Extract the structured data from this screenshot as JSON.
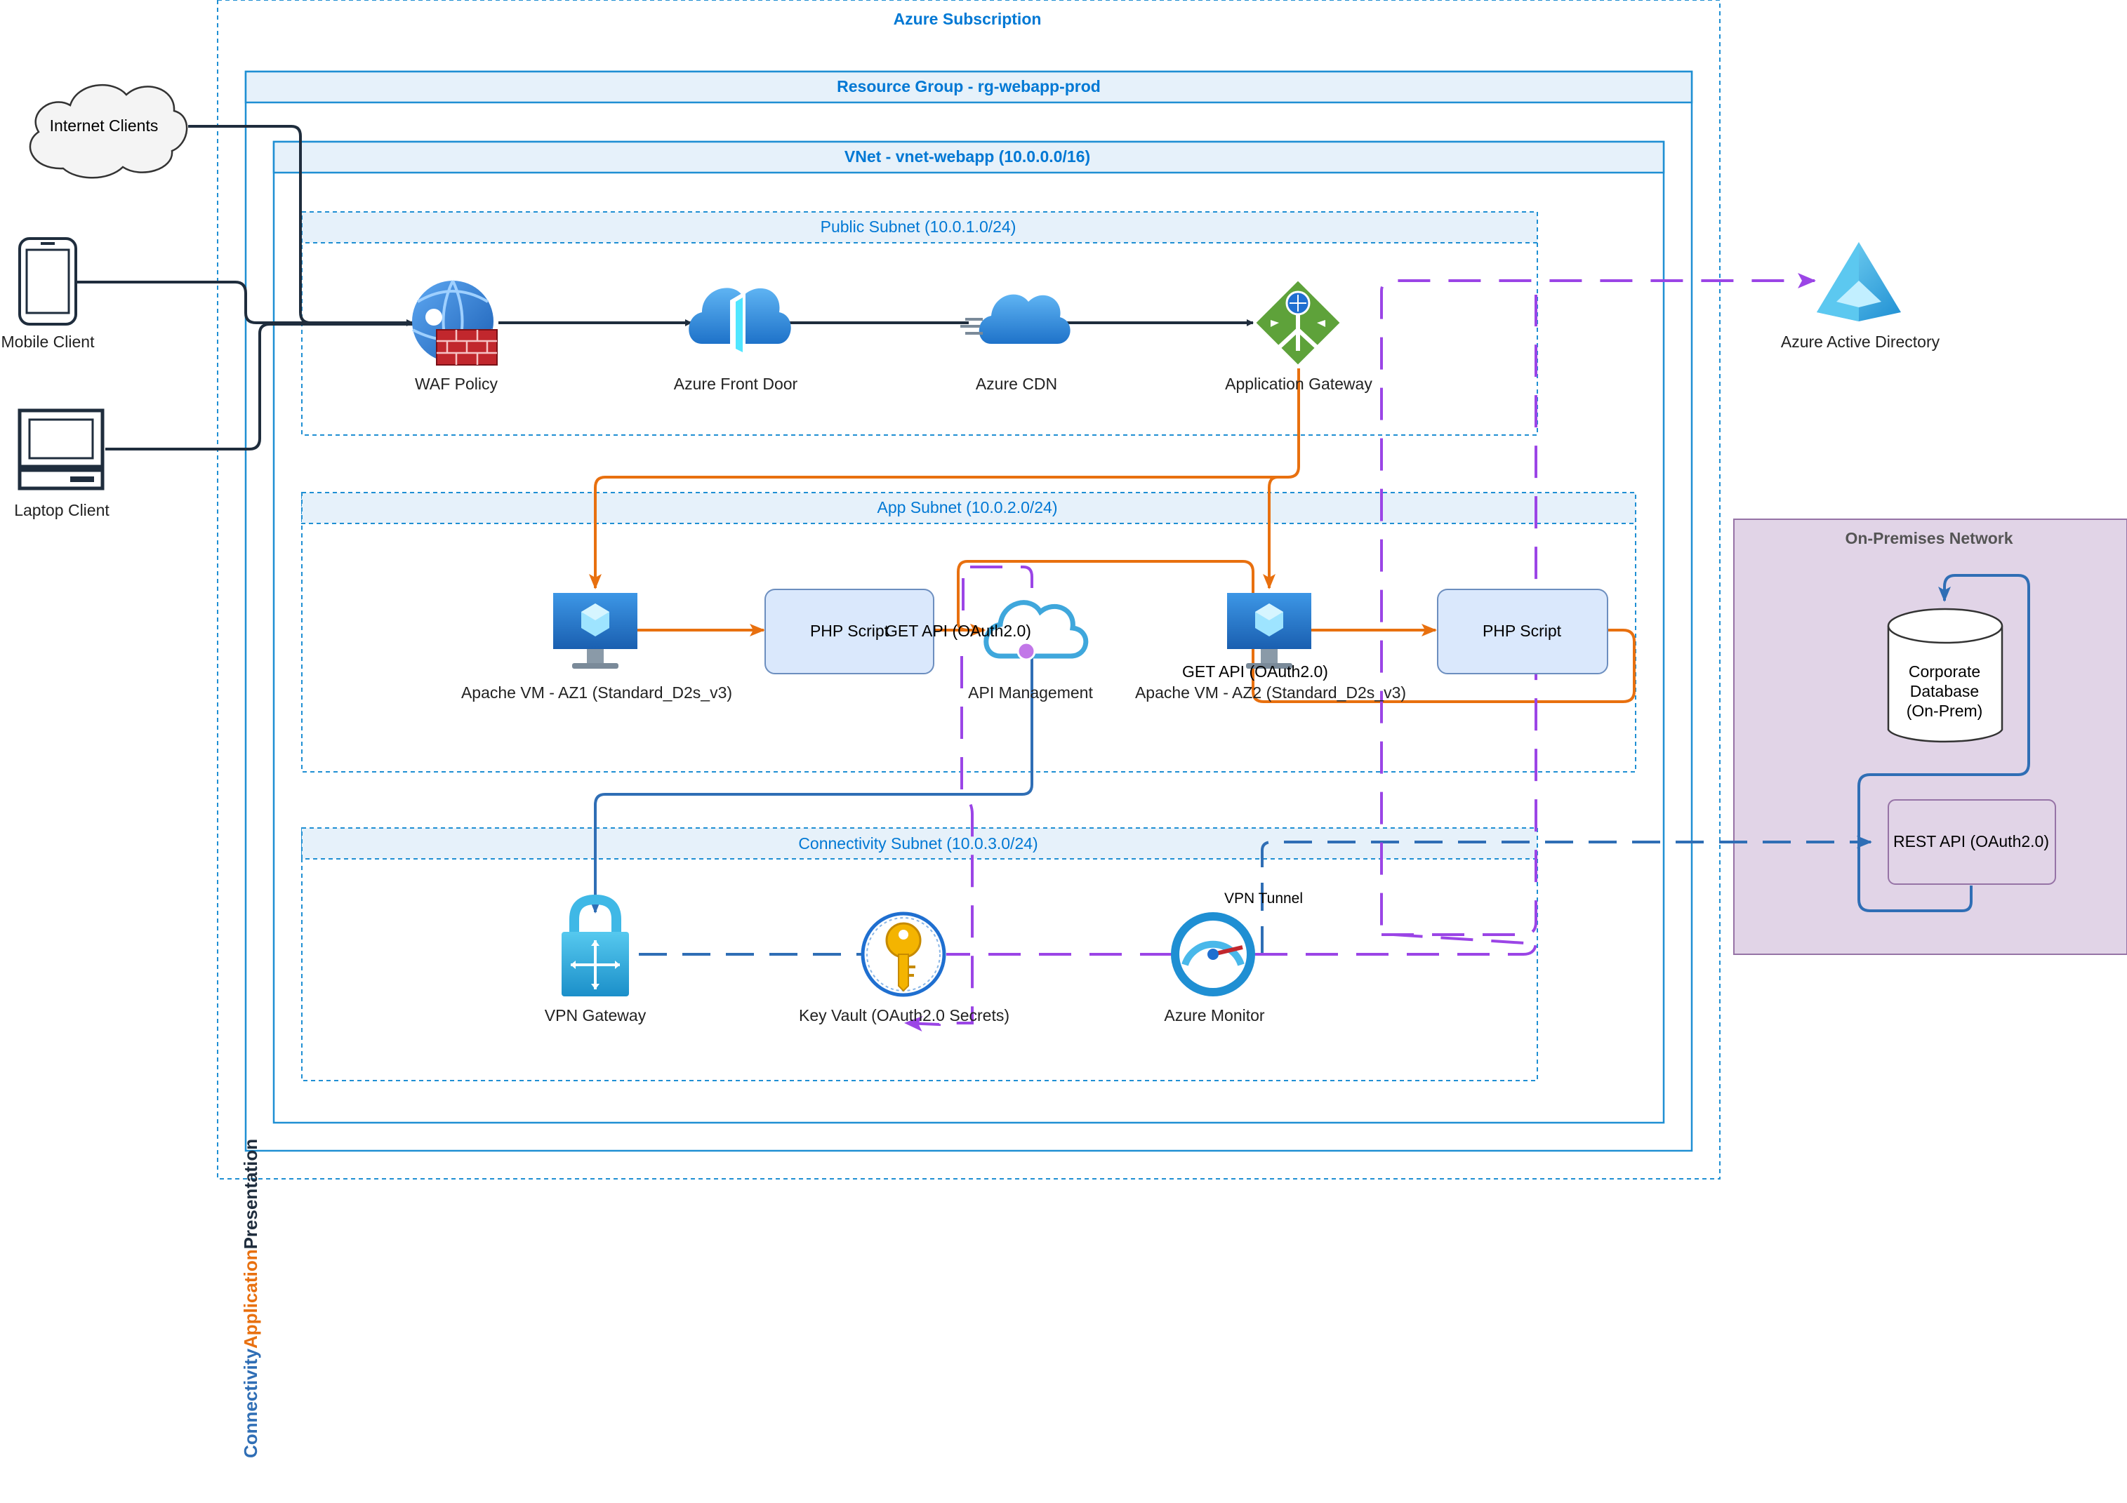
{
  "containers": {
    "subscription": "Azure Subscription",
    "resource_group": "Resource Group - rg-webapp-prod",
    "vnet": "VNet - vnet-webapp (10.0.0.0/16)",
    "public_subnet": "Public Subnet (10.0.1.0/24)",
    "app_subnet": "App Subnet (10.0.2.0/24)",
    "connectivity_subnet": "Connectivity Subnet (10.0.3.0/24)",
    "onprem": "On-Premises Network"
  },
  "clients": {
    "internet": "Internet Clients",
    "mobile": "Mobile Client",
    "laptop": "Laptop Client"
  },
  "nodes": {
    "waf": "WAF Policy",
    "frontdoor": "Azure Front Door",
    "cdn": "Azure CDN",
    "appgw": "Application Gateway",
    "aad": "Azure Active Directory",
    "vm1": "Apache VM - AZ1 (Standard_D2s_v3)",
    "php1": "PHP Script",
    "apim": "API Management",
    "vm2": "Apache VM - AZ2 (Standard_D2s_v3)",
    "php2": "PHP Script",
    "vpngw": "VPN Gateway",
    "keyvault": "Key Vault (OAuth2.0 Secrets)",
    "monitor": "Azure Monitor",
    "db_line1": "Corporate",
    "db_line2": "Database",
    "db_line3": "(On-Prem)",
    "restapi": "REST API (OAuth2.0)"
  },
  "edges": {
    "get_api_1": "GET API (OAuth2.0)",
    "get_api_2": "GET API (OAuth2.0)",
    "vpn_tunnel": "VPN Tunnel"
  },
  "legend": {
    "connectivity": "Connectivity",
    "application": "Application",
    "presentation": "Presentation"
  },
  "colors": {
    "azure_blue": "#0078d4",
    "presentation": "#1f2d3d",
    "application": "#e8700f",
    "connectivity": "#2f6eb5",
    "identity": "#9b45e6",
    "onprem_fill": "#e1d4e7"
  }
}
